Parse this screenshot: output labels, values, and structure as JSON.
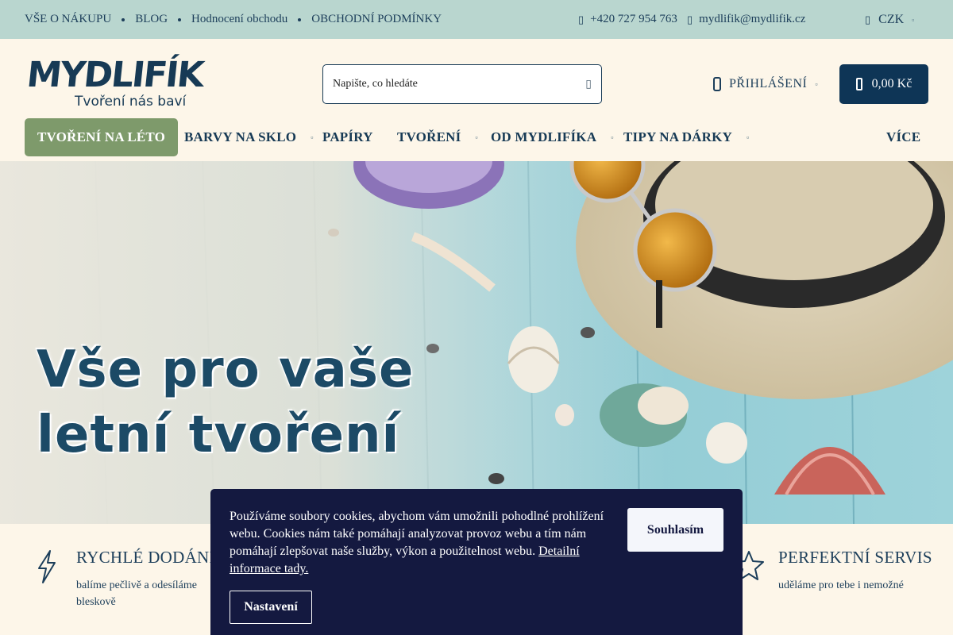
{
  "topbar": {
    "links": [
      "VŠE O NÁKUPU",
      "BLOG",
      "Hodnocení obchodu",
      "OBCHODNÍ PODMÍNKY"
    ],
    "phone": "+420 727 954 763",
    "email": "mydlifik@mydlifik.cz",
    "currency": "CZK"
  },
  "header": {
    "logo_text": "MYDLIFÍK",
    "logo_tagline": "Tvoření nás baví",
    "search_placeholder": "Napište, co hledáte",
    "login_label": "PŘIHLÁŠENÍ",
    "cart_total": "0,00 Kč"
  },
  "nav": {
    "items": [
      "TVOŘENÍ NA LÉTO",
      "BARVY NA SKLO",
      "PAPÍRY",
      "TVOŘENÍ",
      "OD MYDLIFÍKA",
      "TIPY NA DÁRKY"
    ],
    "more": "VÍCE"
  },
  "hero": {
    "line1": "Vše pro vaše",
    "line2": "letní tvoření"
  },
  "features": [
    {
      "title": "RYCHLÉ DODÁNÍ",
      "desc_line1": "balíme pečlivě a odesíláme",
      "desc_line2": "bleskově"
    },
    {
      "title": "PERFEKTNÍ SERVIS",
      "desc_line1": "uděláme pro tebe i nemožné"
    }
  ],
  "cookie": {
    "text": "Používáme soubory cookies, abychom vám umožnili pohodlné prohlížení webu. Cookies nám také pomáhají analyzovat provoz webu a tím nám pomáhají zlepšovat naše služby, výkon a použitelnost webu. ",
    "link": "Detailní informace tady.",
    "agree": "Souhlasím",
    "settings": "Nastavení"
  },
  "colors": {
    "topbar_bg": "#b9d6cf",
    "page_bg": "#fdf6e9",
    "brand_navy": "#0e3556",
    "nav_active": "#7e9a6b",
    "cookie_bg": "#141940"
  }
}
